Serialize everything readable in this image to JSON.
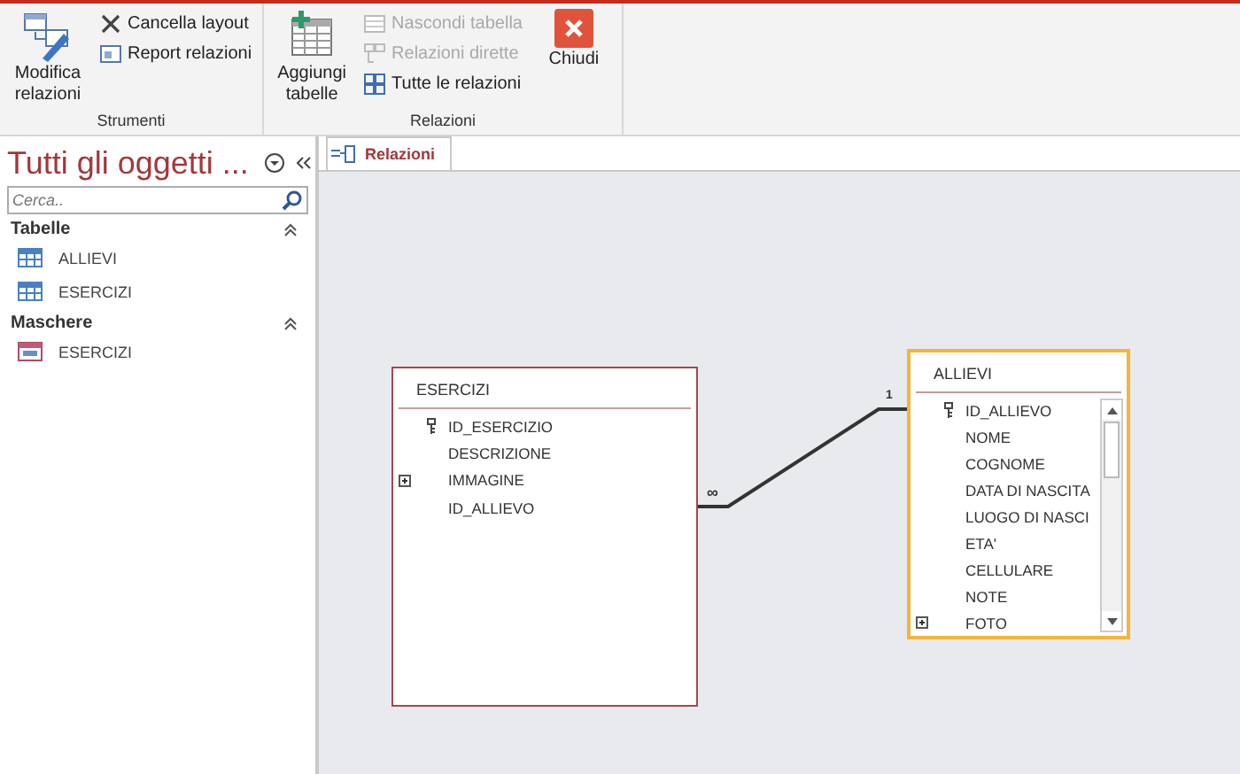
{
  "ribbon": {
    "groups": [
      {
        "label": "Strumenti",
        "buttons": [
          {
            "label": "Modifica relazioni",
            "kind": "large",
            "disabled": false
          },
          {
            "label": "Cancella layout",
            "kind": "small",
            "disabled": false
          },
          {
            "label": "Report relazioni",
            "kind": "small",
            "disabled": false
          }
        ]
      },
      {
        "label": "Relazioni",
        "buttons": [
          {
            "label": "Aggiungi tabelle",
            "kind": "large",
            "disabled": false
          },
          {
            "label": "Nascondi tabella",
            "kind": "small",
            "disabled": true
          },
          {
            "label": "Relazioni dirette",
            "kind": "small",
            "disabled": true
          },
          {
            "label": "Tutte le relazioni",
            "kind": "small",
            "disabled": false
          },
          {
            "label": "Chiudi",
            "kind": "large",
            "disabled": false
          }
        ]
      }
    ]
  },
  "navigation": {
    "title": "Tutti gli oggetti ...",
    "search": {
      "placeholder": "Cerca.."
    },
    "groups": [
      {
        "label": "Tabelle",
        "expanded": true,
        "items": [
          {
            "label": "ALLIEVI",
            "kind": "table"
          },
          {
            "label": "ESERCIZI",
            "kind": "table"
          }
        ]
      },
      {
        "label": "Maschere",
        "expanded": true,
        "items": [
          {
            "label": "ESERCIZI",
            "kind": "form"
          }
        ]
      }
    ]
  },
  "tabs": [
    {
      "label": "Relazioni",
      "selected": true
    }
  ],
  "diagram": {
    "tables": [
      {
        "name": "ESERCIZI",
        "selected": false,
        "fields": [
          {
            "name": "ID_ESERCIZIO",
            "key": true,
            "expandable": false
          },
          {
            "name": "DESCRIZIONE",
            "key": false,
            "expandable": false
          },
          {
            "name": "IMMAGINE",
            "key": false,
            "expandable": true
          },
          {
            "name": "ID_ALLIEVO",
            "key": false,
            "expandable": false
          }
        ]
      },
      {
        "name": "ALLIEVI",
        "selected": true,
        "fields": [
          {
            "name": "ID_ALLIEVO",
            "key": true,
            "expandable": false
          },
          {
            "name": "NOME",
            "key": false,
            "expandable": false
          },
          {
            "name": "COGNOME",
            "key": false,
            "expandable": false
          },
          {
            "name": "DATA DI NASCITA",
            "key": false,
            "expandable": false
          },
          {
            "name": "LUOGO DI NASCI",
            "key": false,
            "expandable": false
          },
          {
            "name": "ETA'",
            "key": false,
            "expandable": false
          },
          {
            "name": "CELLULARE",
            "key": false,
            "expandable": false
          },
          {
            "name": "NOTE",
            "key": false,
            "expandable": false
          },
          {
            "name": "FOTO",
            "key": false,
            "expandable": true
          }
        ]
      }
    ],
    "relationship": {
      "many_end": "∞",
      "one_end": "1"
    }
  }
}
